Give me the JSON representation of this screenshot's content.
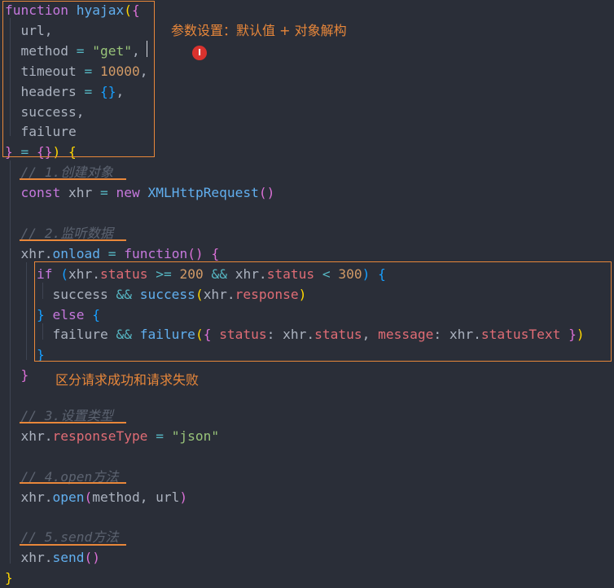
{
  "editor": {
    "lines": [
      [
        [
          "function ",
          "kw"
        ],
        [
          "hyajax",
          "fn"
        ],
        [
          "(",
          "b1"
        ],
        [
          "{",
          "b2"
        ]
      ],
      [
        [
          "  url,",
          "plain"
        ]
      ],
      [
        [
          "  method ",
          "plain"
        ],
        [
          "=",
          "op"
        ],
        [
          " ",
          "plain"
        ],
        [
          "\"get\"",
          "str"
        ],
        [
          ",",
          "plain"
        ]
      ],
      [
        [
          "  timeout ",
          "plain"
        ],
        [
          "=",
          "op"
        ],
        [
          " ",
          "plain"
        ],
        [
          "10000",
          "num"
        ],
        [
          ",",
          "plain"
        ]
      ],
      [
        [
          "  headers ",
          "plain"
        ],
        [
          "=",
          "op"
        ],
        [
          " ",
          "plain"
        ],
        [
          "{}",
          "b3"
        ],
        [
          ",",
          "plain"
        ]
      ],
      [
        [
          "  success,",
          "plain"
        ]
      ],
      [
        [
          "  failure",
          "plain"
        ]
      ],
      [
        [
          "}",
          "b2"
        ],
        [
          " ",
          "plain"
        ],
        [
          "=",
          "op"
        ],
        [
          " ",
          "plain"
        ],
        [
          "{}",
          "b2"
        ],
        [
          ")",
          "b1"
        ],
        [
          " ",
          "plain"
        ],
        [
          "{",
          "b1"
        ]
      ],
      [
        [
          "  // 1.创建对象",
          "cm"
        ]
      ],
      [
        [
          "  ",
          "plain"
        ],
        [
          "const",
          "kw"
        ],
        [
          " xhr ",
          "plain"
        ],
        [
          "=",
          "op"
        ],
        [
          " ",
          "plain"
        ],
        [
          "new",
          "kw"
        ],
        [
          " ",
          "plain"
        ],
        [
          "XMLHttpRequest",
          "fn"
        ],
        [
          "()",
          "b2"
        ]
      ],
      [
        [
          "",
          "plain"
        ]
      ],
      [
        [
          "  // 2.监听数据",
          "cm"
        ]
      ],
      [
        [
          "  xhr.",
          "plain"
        ],
        [
          "onload",
          "fn"
        ],
        [
          " ",
          "plain"
        ],
        [
          "=",
          "op"
        ],
        [
          " ",
          "plain"
        ],
        [
          "function",
          "kw"
        ],
        [
          "()",
          "b2"
        ],
        [
          " ",
          "plain"
        ],
        [
          "{",
          "b2"
        ]
      ],
      [
        [
          "    ",
          "plain"
        ],
        [
          "if",
          "kw"
        ],
        [
          " ",
          "plain"
        ],
        [
          "(",
          "b3"
        ],
        [
          "xhr.",
          "plain"
        ],
        [
          "status",
          "prop"
        ],
        [
          " ",
          "plain"
        ],
        [
          ">=",
          "op"
        ],
        [
          " ",
          "plain"
        ],
        [
          "200",
          "num"
        ],
        [
          " ",
          "plain"
        ],
        [
          "&&",
          "op"
        ],
        [
          " xhr.",
          "plain"
        ],
        [
          "status",
          "prop"
        ],
        [
          " ",
          "plain"
        ],
        [
          "<",
          "op"
        ],
        [
          " ",
          "plain"
        ],
        [
          "300",
          "num"
        ],
        [
          ")",
          "b3"
        ],
        [
          " ",
          "plain"
        ],
        [
          "{",
          "b3"
        ]
      ],
      [
        [
          "      success ",
          "plain"
        ],
        [
          "&&",
          "op"
        ],
        [
          " ",
          "plain"
        ],
        [
          "success",
          "fn"
        ],
        [
          "(",
          "b1"
        ],
        [
          "xhr.",
          "plain"
        ],
        [
          "response",
          "prop"
        ],
        [
          ")",
          "b1"
        ]
      ],
      [
        [
          "    ",
          "plain"
        ],
        [
          "}",
          "b3"
        ],
        [
          " ",
          "plain"
        ],
        [
          "else",
          "kw"
        ],
        [
          " ",
          "plain"
        ],
        [
          "{",
          "b3"
        ]
      ],
      [
        [
          "      failure ",
          "plain"
        ],
        [
          "&&",
          "op"
        ],
        [
          " ",
          "plain"
        ],
        [
          "failure",
          "fn"
        ],
        [
          "(",
          "b1"
        ],
        [
          "{",
          "b2"
        ],
        [
          " ",
          "plain"
        ],
        [
          "status",
          "prop"
        ],
        [
          ": xhr.",
          "plain"
        ],
        [
          "status",
          "prop"
        ],
        [
          ", ",
          "plain"
        ],
        [
          "message",
          "prop"
        ],
        [
          ": xhr.",
          "plain"
        ],
        [
          "statusText",
          "prop"
        ],
        [
          " ",
          "plain"
        ],
        [
          "}",
          "b2"
        ],
        [
          ")",
          "b1"
        ]
      ],
      [
        [
          "    ",
          "plain"
        ],
        [
          "}",
          "b3"
        ]
      ],
      [
        [
          "  ",
          "plain"
        ],
        [
          "}",
          "b2"
        ]
      ],
      [
        [
          "",
          "plain"
        ]
      ],
      [
        [
          "  // 3.设置类型",
          "cm"
        ]
      ],
      [
        [
          "  xhr.",
          "plain"
        ],
        [
          "responseType",
          "prop"
        ],
        [
          " ",
          "plain"
        ],
        [
          "=",
          "op"
        ],
        [
          " ",
          "plain"
        ],
        [
          "\"json\"",
          "str"
        ]
      ],
      [
        [
          "",
          "plain"
        ]
      ],
      [
        [
          "  // 4.open方法",
          "cm"
        ]
      ],
      [
        [
          "  xhr.",
          "plain"
        ],
        [
          "open",
          "fn"
        ],
        [
          "(",
          "b2"
        ],
        [
          "method, url",
          "plain"
        ],
        [
          ")",
          "b2"
        ]
      ],
      [
        [
          "",
          "plain"
        ]
      ],
      [
        [
          "  // 5.send方法",
          "cm"
        ]
      ],
      [
        [
          "  xhr.",
          "plain"
        ],
        [
          "send",
          "fn"
        ],
        [
          "()",
          "b2"
        ]
      ],
      [
        [
          "}",
          "b1"
        ]
      ]
    ]
  },
  "annotations": {
    "params_note": "参数设置：默认值 + 对象解构",
    "branch_note": "区分请求成功和请求失败"
  },
  "colors": {
    "annotation": "#e8873a",
    "background": "#2a2e38"
  },
  "icons": {
    "cursor": "text-cursor-icon"
  }
}
